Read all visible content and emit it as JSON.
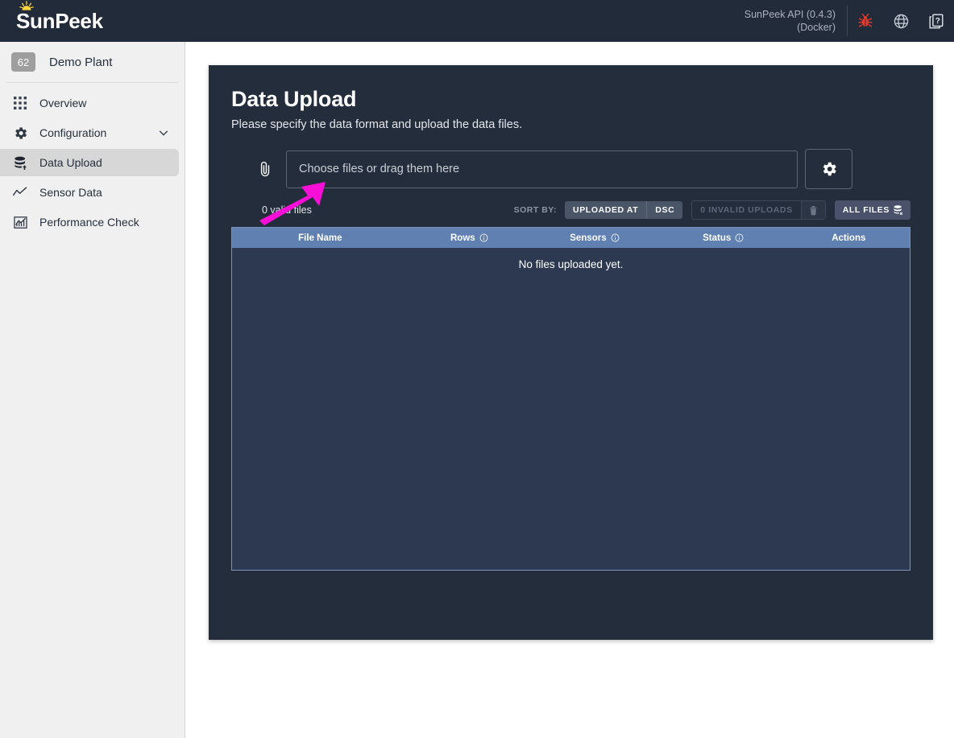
{
  "topbar": {
    "logo_text": "SunPeek",
    "logo_icon": "sun-icon",
    "api_line1": "SunPeek API (0.4.3)",
    "api_line2": "(Docker)",
    "icons": [
      {
        "name": "bug-icon",
        "label": "bug",
        "color": "#e8392a"
      },
      {
        "name": "globe-icon",
        "label": "globe",
        "color": "#c5cbd4"
      },
      {
        "name": "help-docs-icon",
        "label": "help",
        "color": "#e6e9ed"
      }
    ]
  },
  "sidebar": {
    "plant_badge": "62",
    "plant_name": "Demo Plant",
    "items": [
      {
        "label": "Overview",
        "icon": "grid-icon",
        "active": false,
        "chevron": false
      },
      {
        "label": "Configuration",
        "icon": "gear-icon",
        "active": false,
        "chevron": true
      },
      {
        "label": "Data Upload",
        "icon": "database-upload-icon",
        "active": true,
        "chevron": false
      },
      {
        "label": "Sensor Data",
        "icon": "line-chart-icon",
        "active": false,
        "chevron": false
      },
      {
        "label": "Performance Check",
        "icon": "bar-chart-box-icon",
        "active": false,
        "chevron": false
      }
    ]
  },
  "main": {
    "title": "Data Upload",
    "subtitle": "Please specify the data format and upload the data files.",
    "upload": {
      "clip_icon": "paperclip-icon",
      "placeholder": "Choose files or drag them here",
      "settings_icon": "gear-icon"
    },
    "meta": {
      "valid_files": "0 valid files",
      "sort_by_label": "SORT BY:",
      "sort_field": "UPLOADED AT",
      "sort_direction": "DSC",
      "invalid_uploads": "0 INVALID UPLOADS",
      "invalid_uploads_icon": "trash-icon",
      "all_files": "ALL FILES",
      "all_files_icon": "database-delete-icon"
    },
    "table": {
      "columns": [
        {
          "label": "File Name",
          "info": false
        },
        {
          "label": "Rows",
          "info": true
        },
        {
          "label": "Sensors",
          "info": true
        },
        {
          "label": "Status",
          "info": true
        },
        {
          "label": "Actions",
          "info": false
        }
      ],
      "rows": [],
      "empty_message": "No files uploaded yet."
    }
  },
  "annotation": {
    "type": "arrow",
    "color": "#f70fd8",
    "points_to": "file-input-field"
  },
  "colors": {
    "topbar_bg": "#222b3a",
    "sidebar_bg": "#f0f0f0",
    "sidebar_active": "#d7d7d7",
    "card_bg": "#242d3c",
    "table_header": "#5f80b0",
    "table_body": "#2c3950",
    "table_border": "#7b93b8",
    "accent_bug": "#e8392a",
    "annotation": "#f70fd8"
  }
}
